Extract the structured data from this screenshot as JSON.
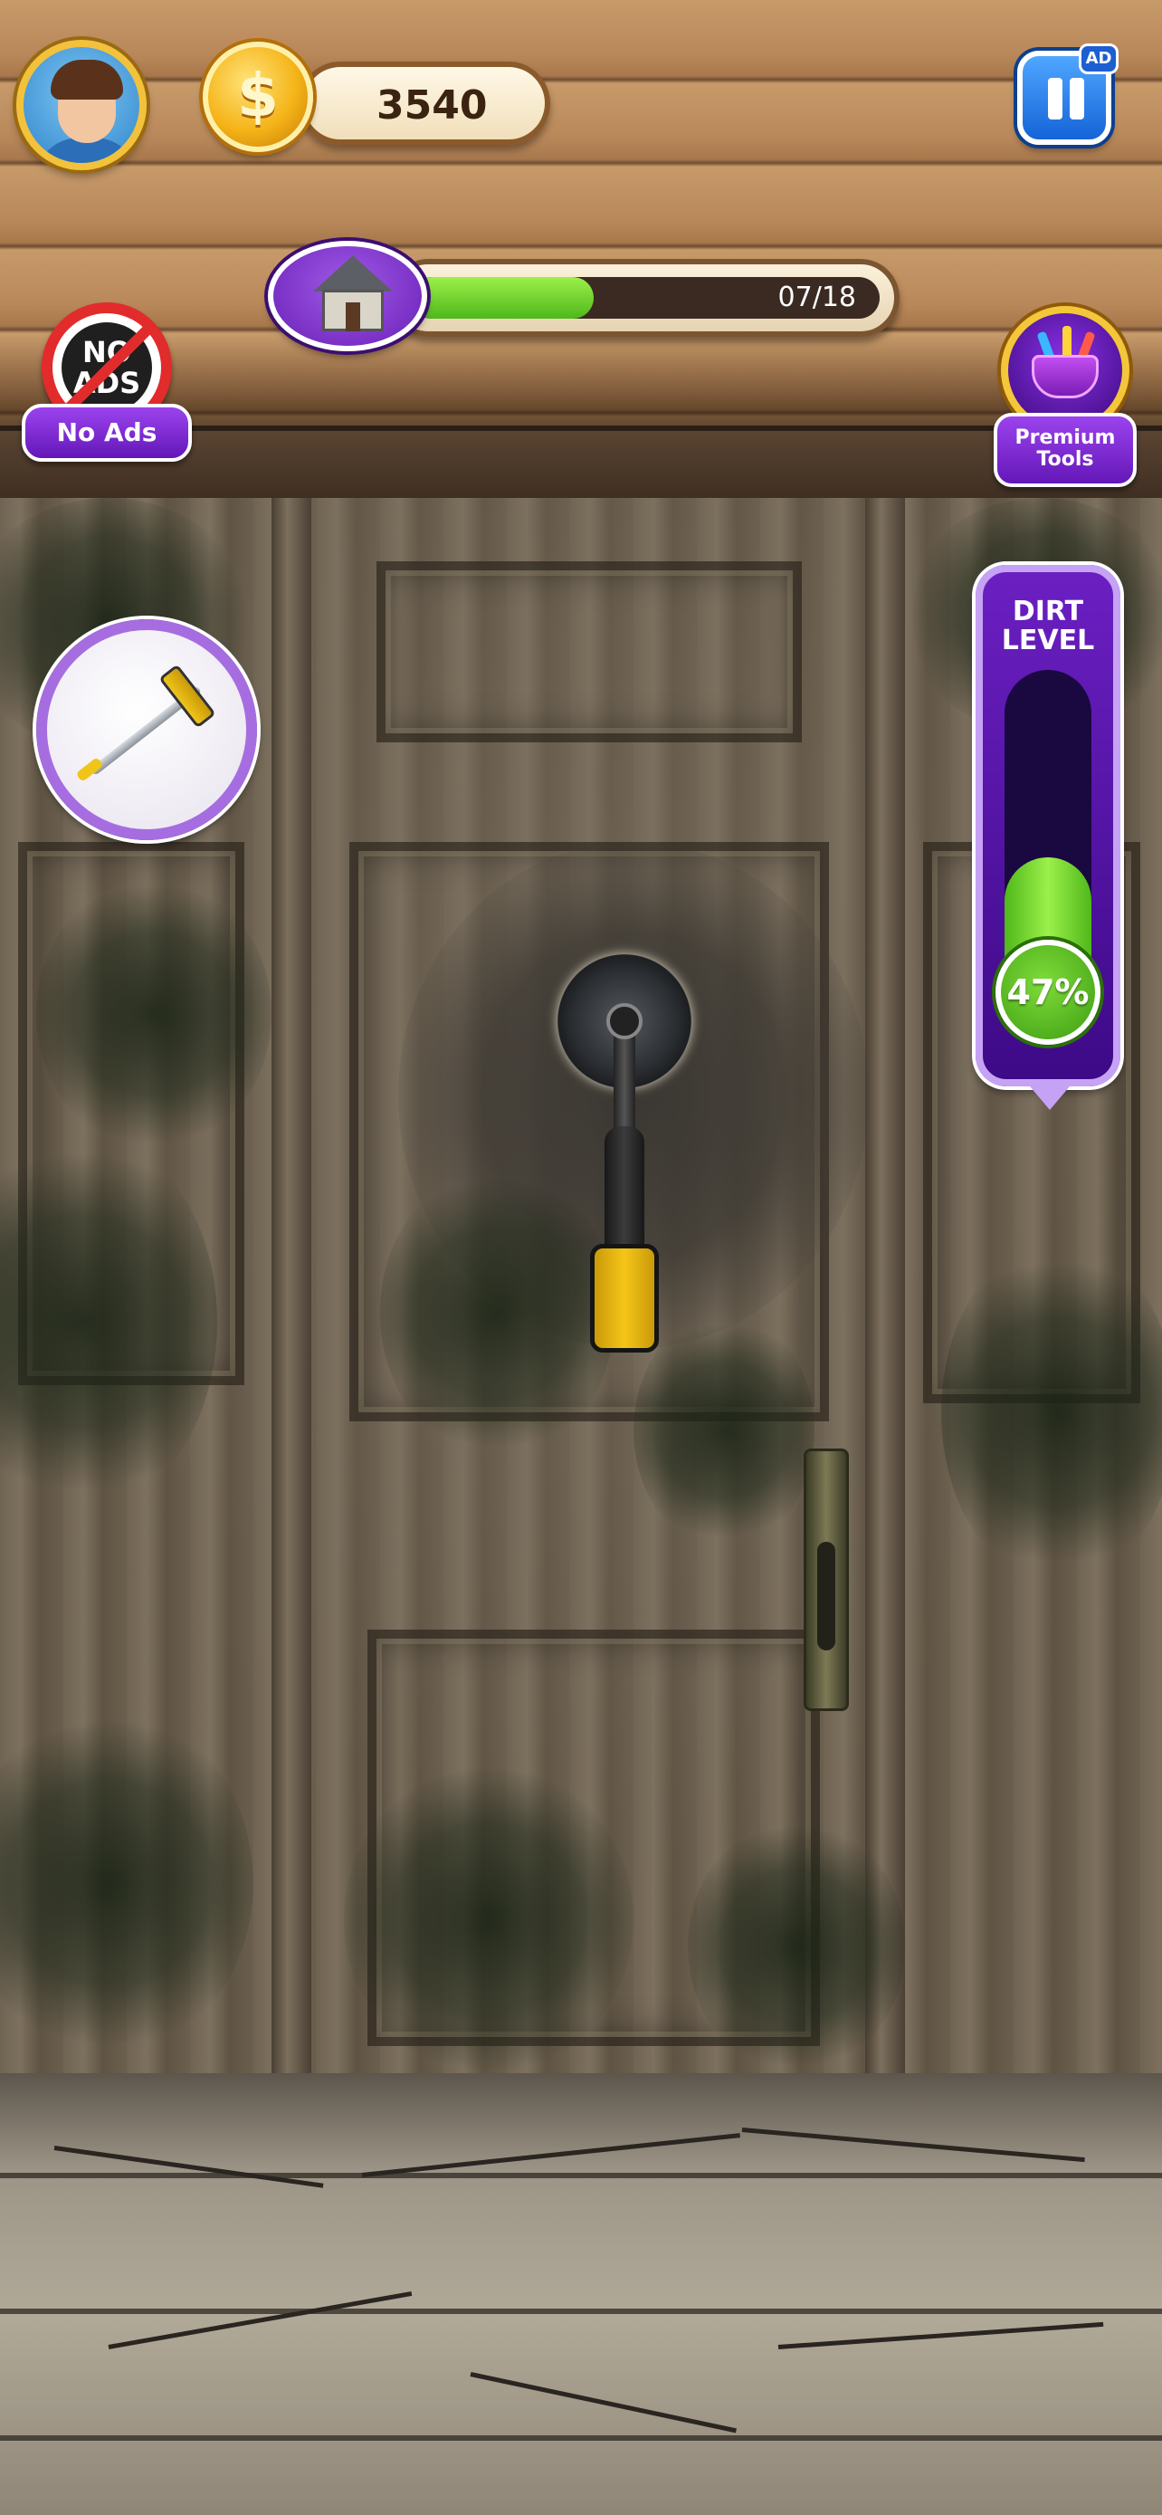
{
  "hud": {
    "coins": "3540",
    "coin_symbol": "$",
    "ad_badge": "AD",
    "level_progress": {
      "current": 7,
      "total": 18,
      "label": "07/18"
    }
  },
  "side_buttons": {
    "no_ads": {
      "badge_text": "NO\nADS",
      "label": "No Ads"
    },
    "premium_tools": {
      "label": "Premium Tools"
    }
  },
  "dirt_meter": {
    "title": "DIRT LEVEL",
    "percent": 47,
    "percent_label": "47%"
  },
  "tools": {
    "selected": "mop-icon",
    "active": "power-scrubber-icon"
  },
  "colors": {
    "accent_purple": "#6a1fb6",
    "progress_green": "#4fb81a",
    "coin_gold": "#f5b418",
    "pause_blue": "#1563d8"
  }
}
